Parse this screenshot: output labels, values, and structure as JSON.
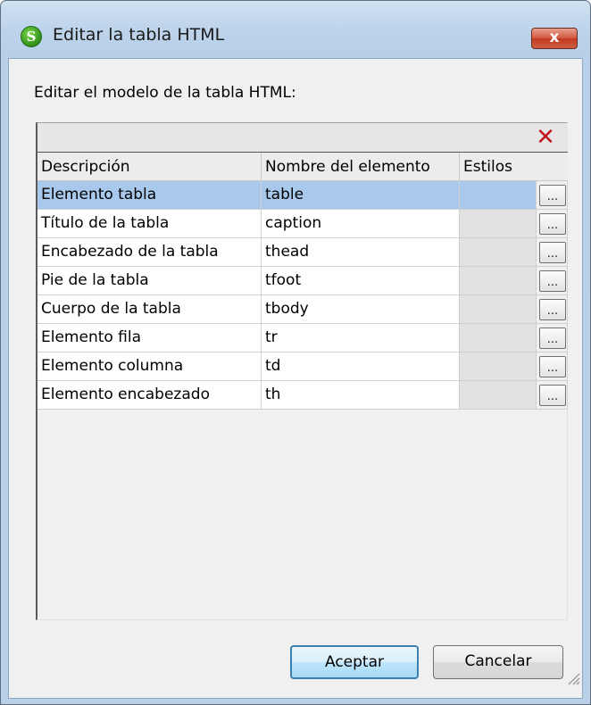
{
  "window": {
    "title": "Editar la tabla HTML",
    "close_label": "x"
  },
  "main": {
    "label": "Editar el modelo de la tabla HTML:"
  },
  "grid": {
    "delete_glyph": "✕",
    "headers": {
      "description": "Descripción",
      "element_name": "Nombre del elemento",
      "styles": "Estilos"
    },
    "rows": [
      {
        "description": "Elemento tabla",
        "element": "table",
        "selected": true
      },
      {
        "description": "Título de la tabla",
        "element": "caption"
      },
      {
        "description": "Encabezado de la tabla",
        "element": "thead"
      },
      {
        "description": "Pie de la tabla",
        "element": "tfoot"
      },
      {
        "description": "Cuerpo de la tabla",
        "element": "tbody"
      },
      {
        "description": "Elemento fila",
        "element": "tr"
      },
      {
        "description": "Elemento columna",
        "element": "td"
      },
      {
        "description": "Elemento encabezado",
        "element": "th"
      }
    ],
    "dots_label": "..."
  },
  "buttons": {
    "ok_label": "Aceptar",
    "cancel_label": "Cancelar"
  },
  "colors": {
    "selection": "#a8c9ec",
    "close_red": "#c03b22",
    "delete_red": "#c0161e"
  }
}
